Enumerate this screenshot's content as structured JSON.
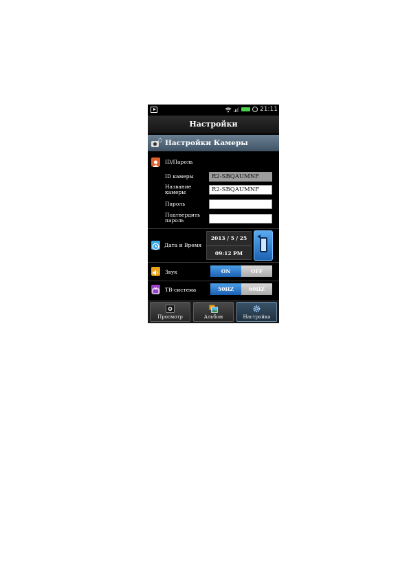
{
  "status_bar": {
    "time": "21:11"
  },
  "header": {
    "title": "Настройки"
  },
  "section": {
    "title": "Настройки Камеры"
  },
  "id_password": {
    "heading": "ID/Пароль",
    "camera_id_label": "ID камеры",
    "camera_id_value": "R2-SBQAUMNF",
    "camera_name_label": "Название камеры",
    "camera_name_value": "R2-SBQAUMNF",
    "password_label": "Пароль",
    "password_value": "",
    "confirm_password_label": "Подтвердить пароль",
    "confirm_password_value": ""
  },
  "datetime": {
    "label": "Дата и Время",
    "date": "2013 / 5 / 25",
    "time": "09:12 PM"
  },
  "sound": {
    "label": "Звук",
    "on": "ON",
    "off": "OFF"
  },
  "tv_system": {
    "label": "ТВ-система",
    "opt1": "50HZ",
    "opt2": "60HZ"
  },
  "nav": {
    "preview": "Просмотр",
    "album": "Альбом",
    "settings": "Настройка"
  },
  "colors": {
    "accent_blue": "#1c5fb0",
    "section_bg": "#4f6477",
    "user_icon": "#e0602a",
    "clock_icon": "#3aa7e8",
    "sound_icon": "#e8a21c",
    "tv_icon": "#9a3fc9"
  }
}
